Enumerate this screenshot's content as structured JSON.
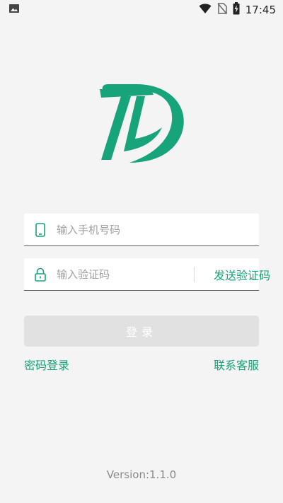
{
  "status_bar": {
    "time": "17:45",
    "left_icons": [
      "image-notification-icon"
    ],
    "right_icons": [
      "wifi-icon",
      "no-sim-icon",
      "battery-charging-icon"
    ]
  },
  "logo": {
    "icon": "app-logo-d",
    "color": "#17a47a"
  },
  "form": {
    "phone": {
      "icon": "phone-icon",
      "placeholder": "输入手机号码",
      "value": ""
    },
    "code": {
      "icon": "lock-icon",
      "placeholder": "输入验证码",
      "value": "",
      "send_label": "发送验证码"
    },
    "login_label": "登录"
  },
  "links": {
    "password_login": "密码登录",
    "contact_support": "联系客服"
  },
  "footer": {
    "version": "Version:1.1.0"
  },
  "colors": {
    "accent": "#17a47a",
    "background": "#f4f4f4",
    "button_disabled": "#e1e1e1"
  }
}
